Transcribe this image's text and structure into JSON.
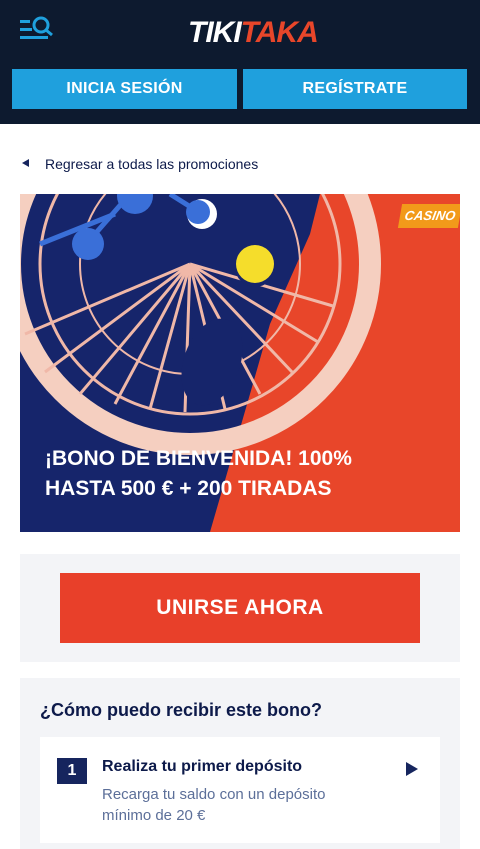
{
  "header": {
    "logo": {
      "part1": "TIKI",
      "part2": "TAKA"
    },
    "login_label": "INICIA SESIÓN",
    "register_label": "REGÍSTRATE",
    "icons": {
      "menu": "menu-search-icon"
    },
    "colors": {
      "background": "#0d1a2f",
      "button": "#1fa0dd",
      "brand_accent": "#e8462a"
    }
  },
  "back_link": {
    "label": "Regresar a todas las promociones",
    "icon": "triangle-left-icon"
  },
  "banner": {
    "badge": "CASINO",
    "title": "¡BONO DE BIENVENIDA! 100% HASTA 500 € + 200 TIRADAS",
    "colors": {
      "orange": "#e8462a",
      "navy": "#16256b",
      "badge": "#f29a1a",
      "ball": "#f5dd2b"
    }
  },
  "join": {
    "button_label": "UNIRSE AHORA",
    "color": "#e8402a"
  },
  "how": {
    "title": "¿Cómo puedo recibir este bono?",
    "steps": [
      {
        "number": "1",
        "title": "Realiza tu primer depósito",
        "description": "Recarga tu saldo con un depósito mínimo de 20 €",
        "icon": "play-arrow-icon"
      }
    ]
  }
}
